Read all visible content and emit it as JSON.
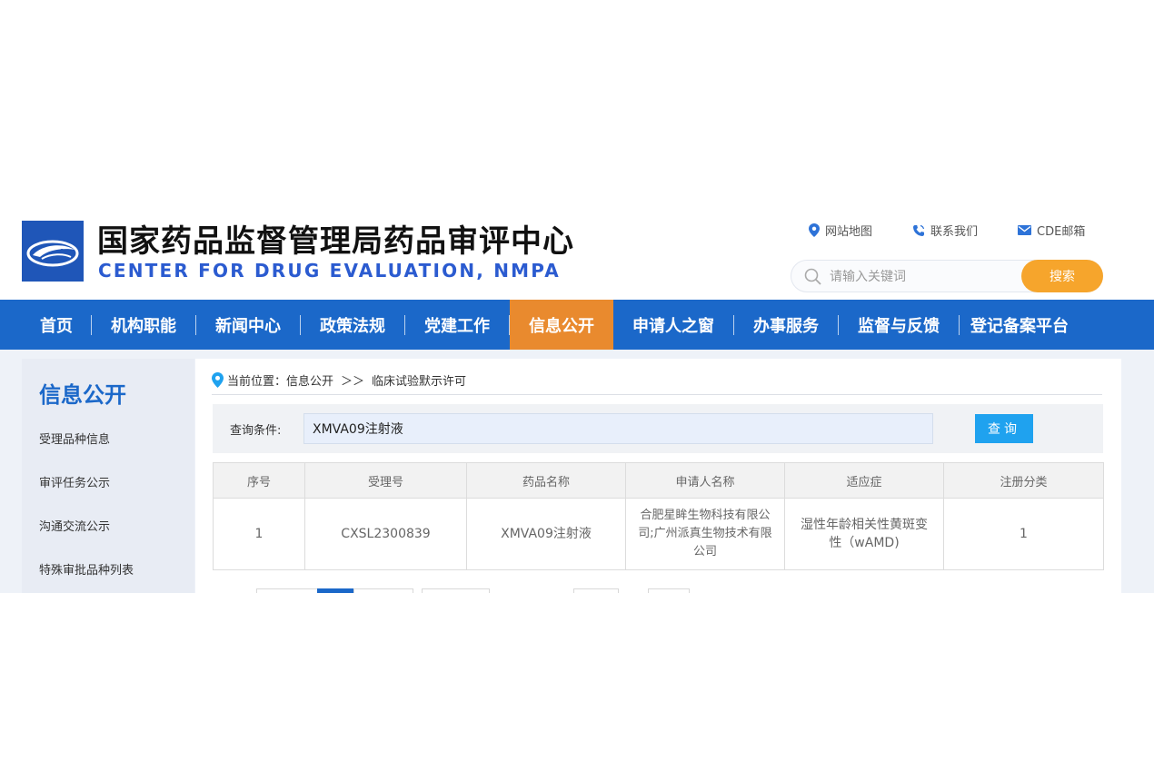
{
  "header": {
    "title": "国家药品监督管理局药品审评中心",
    "subtitle": "CENTER FOR DRUG EVALUATION, NMPA",
    "links": [
      {
        "label": "网站地图",
        "icon": "location-pin-icon"
      },
      {
        "label": "联系我们",
        "icon": "phone-icon"
      },
      {
        "label": "CDE邮箱",
        "icon": "mail-icon"
      }
    ],
    "search": {
      "placeholder": "请输入关键词",
      "button": "搜索"
    }
  },
  "nav": {
    "items": [
      {
        "label": "首页"
      },
      {
        "label": "机构职能"
      },
      {
        "label": "新闻中心"
      },
      {
        "label": "政策法规"
      },
      {
        "label": "党建工作"
      },
      {
        "label": "信息公开",
        "active": true
      },
      {
        "label": "申请人之窗"
      },
      {
        "label": "办事服务"
      },
      {
        "label": "监督与反馈"
      },
      {
        "label": "登记备案平台"
      }
    ]
  },
  "sidebar": {
    "title": "信息公开",
    "items": [
      {
        "label": "受理品种信息"
      },
      {
        "label": "审评任务公示"
      },
      {
        "label": "沟通交流公示"
      },
      {
        "label": "特殊审批品种列表"
      }
    ]
  },
  "breadcrumb": {
    "prefix": "当前位置：",
    "level1": "信息公开",
    "sep": "＞＞",
    "level2": "临床试验默示许可"
  },
  "query": {
    "label": "查询条件:",
    "value": "XMVA09注射液",
    "button": "查询"
  },
  "table": {
    "headers": [
      "序号",
      "受理号",
      "药品名称",
      "申请人名称",
      "适应症",
      "注册分类"
    ],
    "rows": [
      [
        "1",
        "CXSL2300839",
        "XMVA09注射液",
        "合肥星眸生物科技有限公司;广州派真生物技术有限公司",
        "湿性年龄相关性黄斑变性（wAMD)",
        "1"
      ]
    ]
  },
  "colors": {
    "nav_bg": "#1b68c9",
    "nav_active": "#e98a2e",
    "search_button": "#f6a52c",
    "query_button": "#1fa2ef"
  }
}
